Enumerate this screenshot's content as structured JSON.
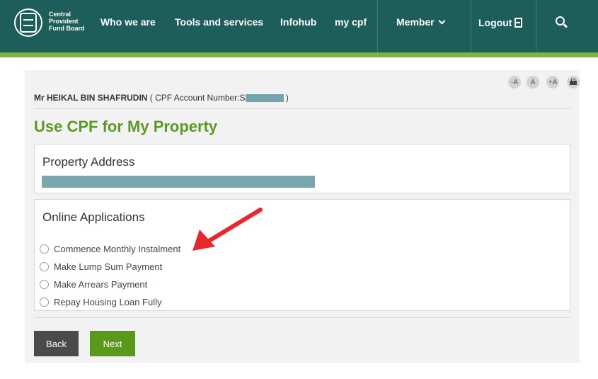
{
  "header": {
    "logo_text": [
      "Central",
      "Provident",
      "Fund Board"
    ],
    "nav": {
      "who_we_are": "Who we are",
      "tools_and_services": "Tools and services",
      "infohub": "Infohub",
      "my_cpf": "my cpf",
      "member": "Member",
      "logout": "Logout"
    },
    "colors": {
      "bar": "#1e5e5a",
      "stripe": "#7cb342"
    }
  },
  "toolbar": {
    "decrease_font": "-A",
    "reset_font": "A",
    "increase_font": "+A"
  },
  "account": {
    "name": "Mr HEIKAL BIN SHAFRUDIN",
    "prefix": "( CPF Account Number:S",
    "suffix": ")"
  },
  "page_title": "Use CPF for My Property",
  "property_address": {
    "title": "Property Address"
  },
  "online_applications": {
    "title": "Online Applications",
    "options": [
      "Commence Monthly Instalment",
      "Make Lump Sum Payment",
      "Make Arrears Payment",
      "Repay Housing Loan Fully"
    ]
  },
  "buttons": {
    "back": "Back",
    "next": "Next"
  },
  "accent_colors": {
    "title": "#5b9a22",
    "next": "#5a9a1a",
    "back": "#4a4a4a",
    "arrow": "#e8262b"
  }
}
